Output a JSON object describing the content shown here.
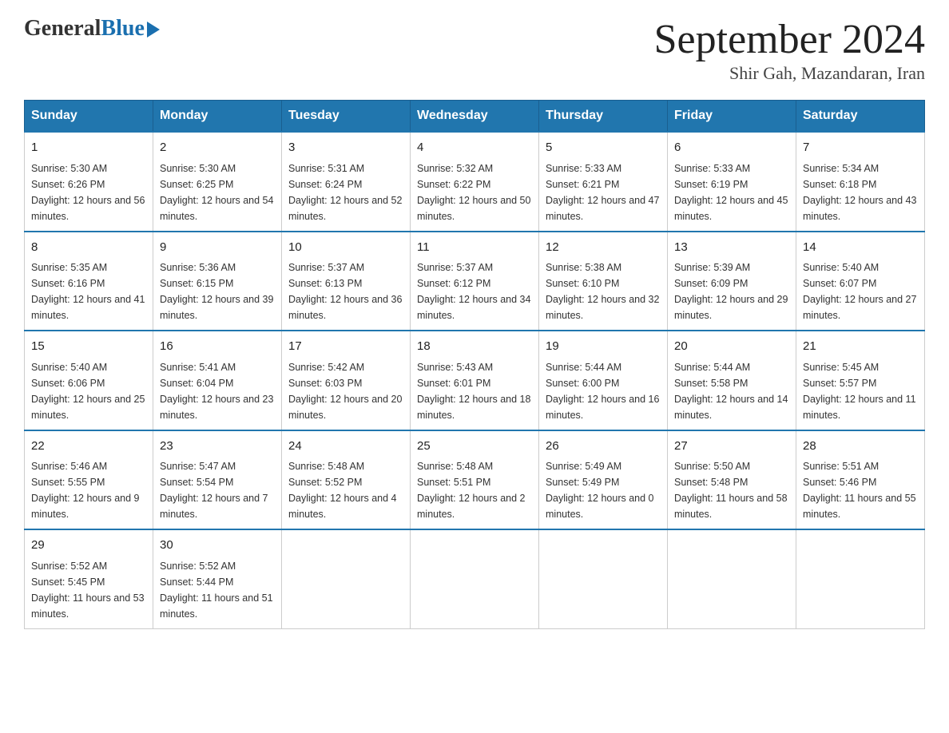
{
  "logo": {
    "general": "General",
    "blue": "Blue"
  },
  "title": "September 2024",
  "location": "Shir Gah, Mazandaran, Iran",
  "headers": [
    "Sunday",
    "Monday",
    "Tuesday",
    "Wednesday",
    "Thursday",
    "Friday",
    "Saturday"
  ],
  "weeks": [
    [
      {
        "day": "1",
        "sunrise": "5:30 AM",
        "sunset": "6:26 PM",
        "daylight": "12 hours and 56 minutes."
      },
      {
        "day": "2",
        "sunrise": "5:30 AM",
        "sunset": "6:25 PM",
        "daylight": "12 hours and 54 minutes."
      },
      {
        "day": "3",
        "sunrise": "5:31 AM",
        "sunset": "6:24 PM",
        "daylight": "12 hours and 52 minutes."
      },
      {
        "day": "4",
        "sunrise": "5:32 AM",
        "sunset": "6:22 PM",
        "daylight": "12 hours and 50 minutes."
      },
      {
        "day": "5",
        "sunrise": "5:33 AM",
        "sunset": "6:21 PM",
        "daylight": "12 hours and 47 minutes."
      },
      {
        "day": "6",
        "sunrise": "5:33 AM",
        "sunset": "6:19 PM",
        "daylight": "12 hours and 45 minutes."
      },
      {
        "day": "7",
        "sunrise": "5:34 AM",
        "sunset": "6:18 PM",
        "daylight": "12 hours and 43 minutes."
      }
    ],
    [
      {
        "day": "8",
        "sunrise": "5:35 AM",
        "sunset": "6:16 PM",
        "daylight": "12 hours and 41 minutes."
      },
      {
        "day": "9",
        "sunrise": "5:36 AM",
        "sunset": "6:15 PM",
        "daylight": "12 hours and 39 minutes."
      },
      {
        "day": "10",
        "sunrise": "5:37 AM",
        "sunset": "6:13 PM",
        "daylight": "12 hours and 36 minutes."
      },
      {
        "day": "11",
        "sunrise": "5:37 AM",
        "sunset": "6:12 PM",
        "daylight": "12 hours and 34 minutes."
      },
      {
        "day": "12",
        "sunrise": "5:38 AM",
        "sunset": "6:10 PM",
        "daylight": "12 hours and 32 minutes."
      },
      {
        "day": "13",
        "sunrise": "5:39 AM",
        "sunset": "6:09 PM",
        "daylight": "12 hours and 29 minutes."
      },
      {
        "day": "14",
        "sunrise": "5:40 AM",
        "sunset": "6:07 PM",
        "daylight": "12 hours and 27 minutes."
      }
    ],
    [
      {
        "day": "15",
        "sunrise": "5:40 AM",
        "sunset": "6:06 PM",
        "daylight": "12 hours and 25 minutes."
      },
      {
        "day": "16",
        "sunrise": "5:41 AM",
        "sunset": "6:04 PM",
        "daylight": "12 hours and 23 minutes."
      },
      {
        "day": "17",
        "sunrise": "5:42 AM",
        "sunset": "6:03 PM",
        "daylight": "12 hours and 20 minutes."
      },
      {
        "day": "18",
        "sunrise": "5:43 AM",
        "sunset": "6:01 PM",
        "daylight": "12 hours and 18 minutes."
      },
      {
        "day": "19",
        "sunrise": "5:44 AM",
        "sunset": "6:00 PM",
        "daylight": "12 hours and 16 minutes."
      },
      {
        "day": "20",
        "sunrise": "5:44 AM",
        "sunset": "5:58 PM",
        "daylight": "12 hours and 14 minutes."
      },
      {
        "day": "21",
        "sunrise": "5:45 AM",
        "sunset": "5:57 PM",
        "daylight": "12 hours and 11 minutes."
      }
    ],
    [
      {
        "day": "22",
        "sunrise": "5:46 AM",
        "sunset": "5:55 PM",
        "daylight": "12 hours and 9 minutes."
      },
      {
        "day": "23",
        "sunrise": "5:47 AM",
        "sunset": "5:54 PM",
        "daylight": "12 hours and 7 minutes."
      },
      {
        "day": "24",
        "sunrise": "5:48 AM",
        "sunset": "5:52 PM",
        "daylight": "12 hours and 4 minutes."
      },
      {
        "day": "25",
        "sunrise": "5:48 AM",
        "sunset": "5:51 PM",
        "daylight": "12 hours and 2 minutes."
      },
      {
        "day": "26",
        "sunrise": "5:49 AM",
        "sunset": "5:49 PM",
        "daylight": "12 hours and 0 minutes."
      },
      {
        "day": "27",
        "sunrise": "5:50 AM",
        "sunset": "5:48 PM",
        "daylight": "11 hours and 58 minutes."
      },
      {
        "day": "28",
        "sunrise": "5:51 AM",
        "sunset": "5:46 PM",
        "daylight": "11 hours and 55 minutes."
      }
    ],
    [
      {
        "day": "29",
        "sunrise": "5:52 AM",
        "sunset": "5:45 PM",
        "daylight": "11 hours and 53 minutes."
      },
      {
        "day": "30",
        "sunrise": "5:52 AM",
        "sunset": "5:44 PM",
        "daylight": "11 hours and 51 minutes."
      },
      null,
      null,
      null,
      null,
      null
    ]
  ]
}
